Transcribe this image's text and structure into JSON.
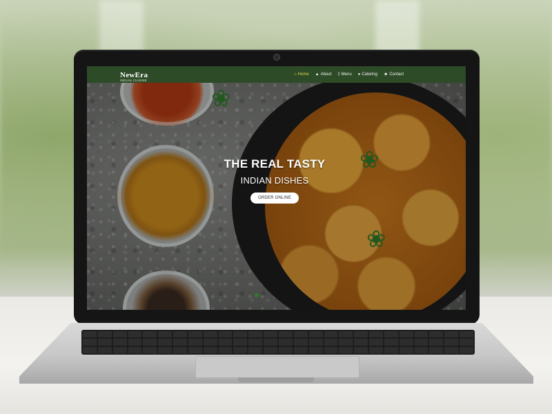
{
  "site": {
    "logo": {
      "brand": "NewEra",
      "tagline": "INDIAN CUISINE"
    },
    "nav": {
      "items": [
        {
          "label": "Home",
          "icon": "home-icon",
          "active": true
        },
        {
          "label": "About",
          "icon": "home-icon",
          "active": false
        },
        {
          "label": "Menu",
          "icon": "fork-knife-icon",
          "active": false
        },
        {
          "label": "Catering",
          "icon": "chef-hat-icon",
          "active": false
        },
        {
          "label": "Contact",
          "icon": "user-icon",
          "active": false
        }
      ]
    },
    "hero": {
      "title": "THE REAL TASTY",
      "subtitle": "INDIAN DISHES",
      "cta": "ORDER ONLINE"
    }
  },
  "colors": {
    "navbar": "#2e4b28",
    "active_nav": "#e3d74d",
    "button_bg": "#ffffff",
    "slider_dot": "#2e7a2a"
  }
}
